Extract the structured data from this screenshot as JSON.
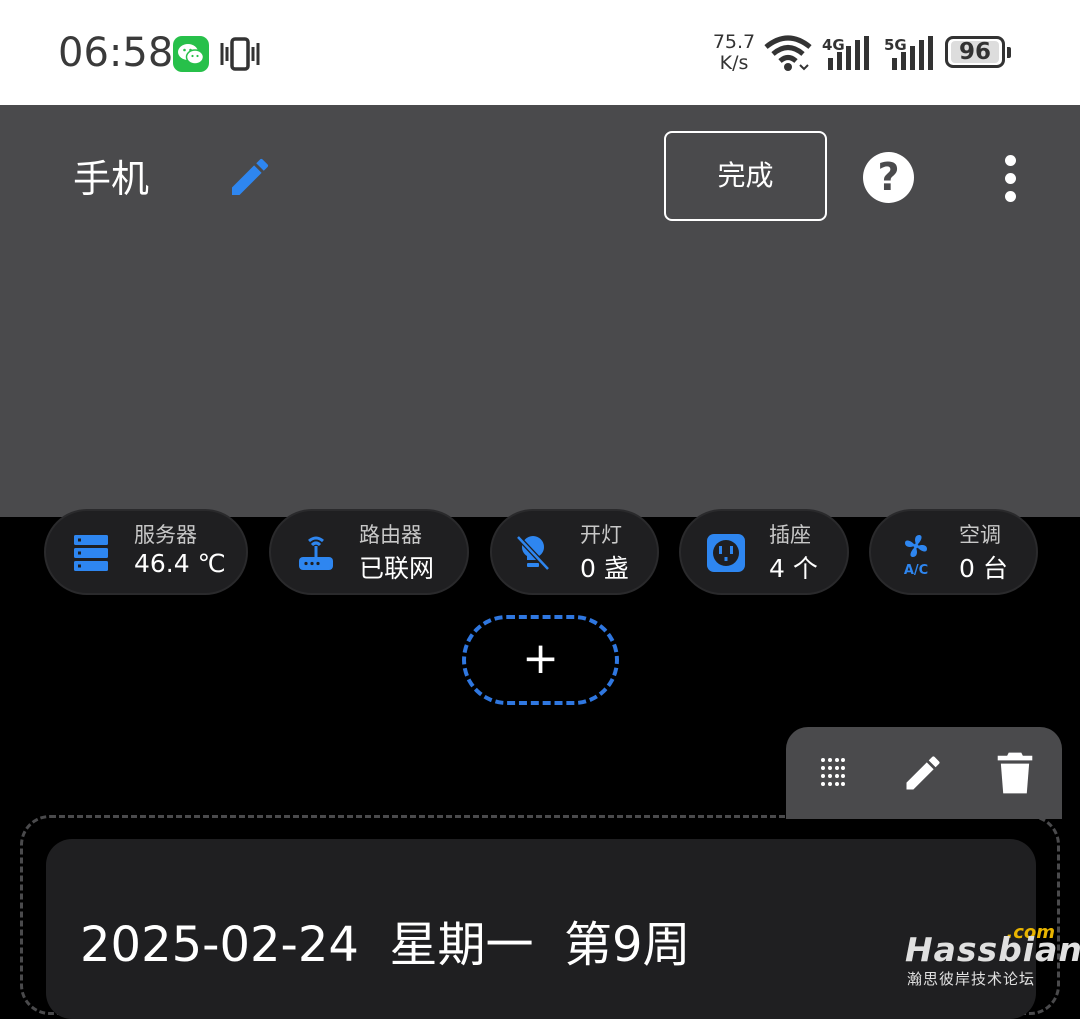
{
  "status_bar": {
    "time": "06:58",
    "net_speed_value": "75.7",
    "net_speed_unit": "K/s",
    "signal_1": "4G",
    "signal_2": "5G",
    "battery": "96"
  },
  "header": {
    "title": "手机",
    "done_label": "完成",
    "help_label": "?"
  },
  "chips": [
    {
      "label": "服务器",
      "value": "46.4 ℃",
      "icon": "server-icon"
    },
    {
      "label": "路由器",
      "value": "已联网",
      "icon": "router-icon"
    },
    {
      "label": "开灯",
      "value": "0 盏",
      "icon": "lightbulb-off-icon"
    },
    {
      "label": "插座",
      "value": "4 个",
      "icon": "power-socket-icon"
    },
    {
      "label": "空调",
      "value": "0 台",
      "icon": "air-conditioner-icon"
    }
  ],
  "add_button": "+",
  "card": {
    "date_text": "2025-02-24  星期一  第9周"
  },
  "watermark": {
    "com": ".com",
    "name": "Hassbian",
    "sub": "瀚思彼岸技术论坛"
  },
  "colors": {
    "accent": "#2f77e0",
    "icon_blue": "#2e86f0",
    "header_bg": "#4a4a4c",
    "chip_bg": "#1f1f21"
  }
}
